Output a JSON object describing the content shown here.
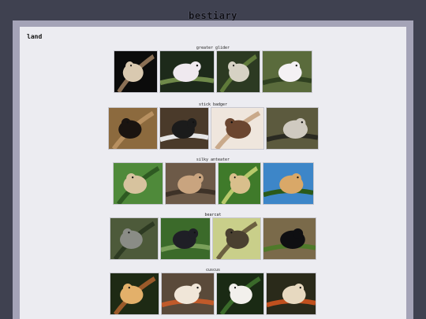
{
  "header": {
    "title": "bestiary"
  },
  "page": {
    "section_title": "land"
  },
  "groups": [
    {
      "label": "greater glider",
      "thumbs": [
        {
          "icon": "greater-glider-photo-1",
          "bg": "#0b0b0b",
          "fg": "#d9c9b0",
          "accent": "#8a6f55"
        },
        {
          "icon": "greater-glider-photo-2",
          "bg": "#1d2a1a",
          "fg": "#efe9ef",
          "accent": "#6f8a4a"
        },
        {
          "icon": "greater-glider-photo-3",
          "bg": "#2c3a22",
          "fg": "#d6d2c4",
          "accent": "#5f7a3a"
        },
        {
          "icon": "greater-glider-photo-4",
          "bg": "#5a6b3c",
          "fg": "#f4f1f4",
          "accent": "#2f4020"
        }
      ]
    },
    {
      "label": "stick badger",
      "thumbs": [
        {
          "icon": "stick-badger-photo-1",
          "bg": "#8c6a3e",
          "fg": "#1a1410",
          "accent": "#b89060"
        },
        {
          "icon": "stick-badger-photo-2",
          "bg": "#4a3a2a",
          "fg": "#1b1b1b",
          "accent": "#e6e6e6"
        },
        {
          "icon": "stick-badger-photo-3",
          "bg": "#efe6dd",
          "fg": "#6b4630",
          "accent": "#c9a98a"
        },
        {
          "icon": "stick-badger-photo-4",
          "bg": "#5c5a3e",
          "fg": "#cfcac0",
          "accent": "#2a2a22"
        }
      ]
    },
    {
      "label": "silky anteater",
      "thumbs": [
        {
          "icon": "silky-anteater-photo-1",
          "bg": "#4f8a3a",
          "fg": "#d7c39e",
          "accent": "#2e5a22"
        },
        {
          "icon": "silky-anteater-photo-2",
          "bg": "#6d5a48",
          "fg": "#c9a47f",
          "accent": "#3e3228"
        },
        {
          "icon": "silky-anteater-photo-3",
          "bg": "#3f7a2a",
          "fg": "#d9bf8c",
          "accent": "#b7c96a"
        },
        {
          "icon": "silky-anteater-photo-4",
          "bg": "#3d86c8",
          "fg": "#d9a868",
          "accent": "#2a5a1a"
        }
      ]
    },
    {
      "label": "bearcat",
      "thumbs": [
        {
          "icon": "bearcat-photo-1",
          "bg": "#4d5a3a",
          "fg": "#8a8c86",
          "accent": "#2d3a22"
        },
        {
          "icon": "bearcat-photo-2",
          "bg": "#3b6a2a",
          "fg": "#1f1f26",
          "accent": "#7aa05a"
        },
        {
          "icon": "bearcat-photo-3",
          "bg": "#c9cf8a",
          "fg": "#4a4030",
          "accent": "#6b6040"
        },
        {
          "icon": "bearcat-photo-4",
          "bg": "#7a6a4a",
          "fg": "#0f0f12",
          "accent": "#4f7a2a"
        }
      ]
    },
    {
      "label": "cuscus",
      "thumbs": [
        {
          "icon": "cuscus-photo-1",
          "bg": "#1e2a14",
          "fg": "#e3b06a",
          "accent": "#9a5a2a"
        },
        {
          "icon": "cuscus-photo-2",
          "bg": "#5a4a3a",
          "fg": "#f0e6d8",
          "accent": "#c05a2a"
        },
        {
          "icon": "cuscus-photo-3",
          "bg": "#1a2a14",
          "fg": "#f2f0ec",
          "accent": "#3a6a2a"
        },
        {
          "icon": "cuscus-photo-4",
          "bg": "#2a2a1a",
          "fg": "#e7d9c0",
          "accent": "#c0501e"
        }
      ]
    }
  ]
}
